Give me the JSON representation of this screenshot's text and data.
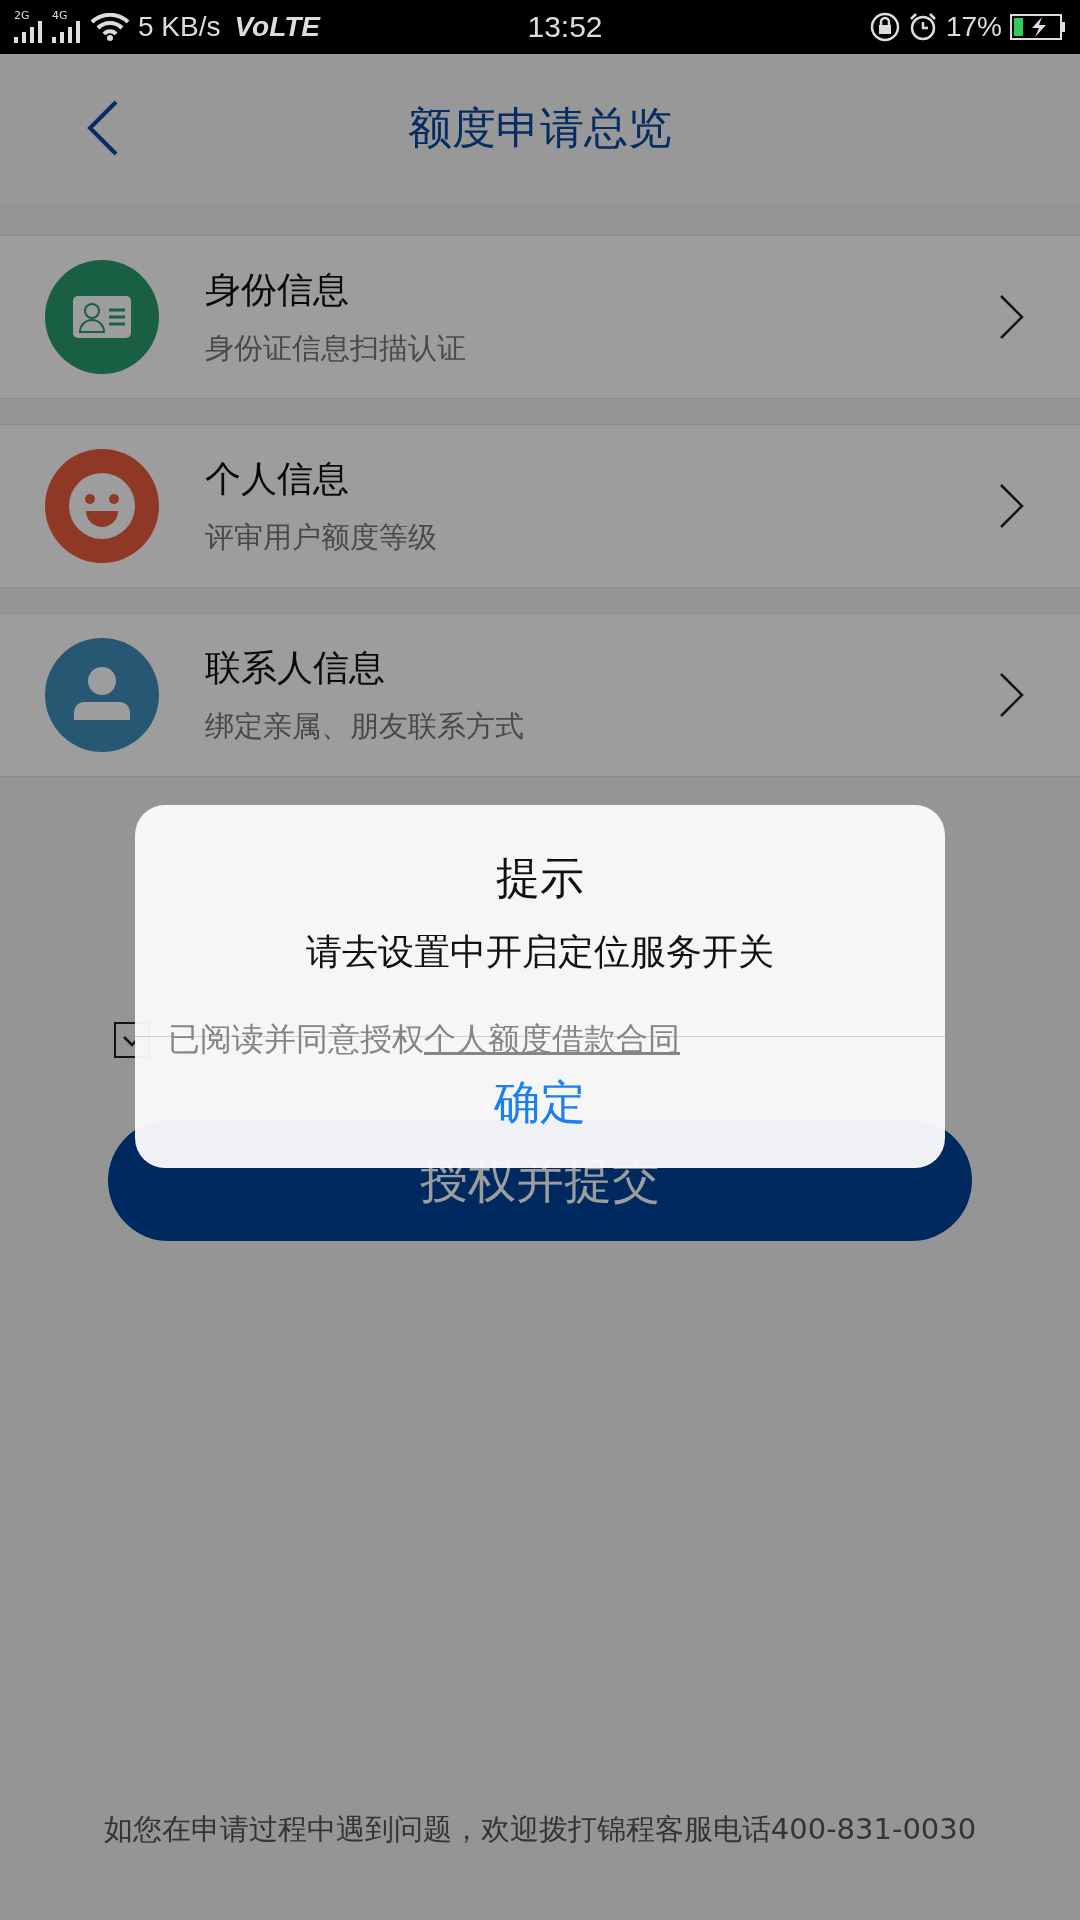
{
  "status_bar": {
    "signal_labels": [
      "2G",
      "4G"
    ],
    "speed": "5 KB/s",
    "volte": "VoLTE",
    "time": "13:52",
    "battery": "17%"
  },
  "header": {
    "title": "额度申请总览"
  },
  "items": [
    {
      "kind": "id-card",
      "title": "身份信息",
      "subtitle": "身份证信息扫描认证"
    },
    {
      "kind": "smiley",
      "title": "个人信息",
      "subtitle": "评审用户额度等级"
    },
    {
      "kind": "contact",
      "title": "联系人信息",
      "subtitle": "绑定亲属、朋友联系方式"
    }
  ],
  "agreement": {
    "checked": true,
    "text": "已阅读并同意授权",
    "link": "个人额度借款合同"
  },
  "submit_button": "授权并提交",
  "dialog": {
    "title": "提示",
    "message": "请去设置中开启定位服务开关",
    "button": "确定"
  },
  "footer": "如您在申请过程中遇到问题，欢迎拨打锦程客服电话400-831-0030"
}
